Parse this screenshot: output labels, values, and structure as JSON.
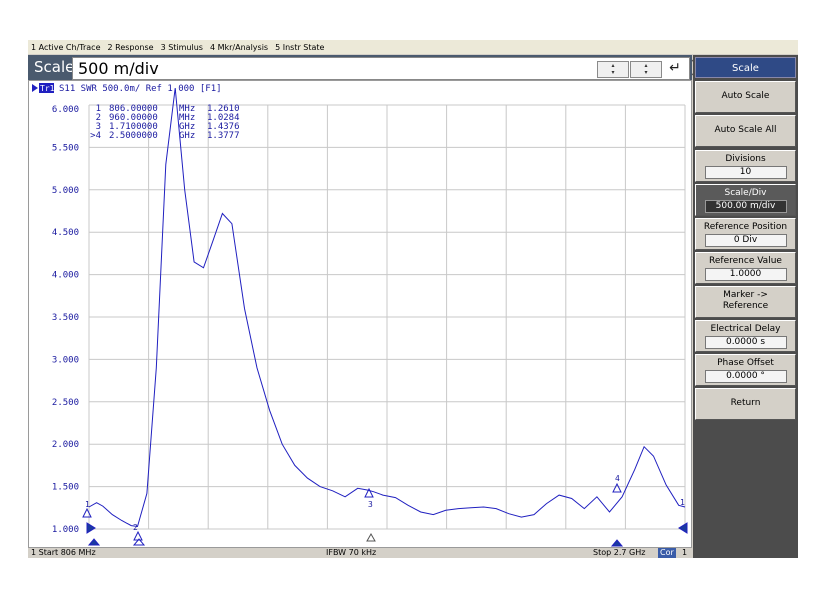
{
  "menu": [
    "1 Active Ch/Trace",
    "2 Response",
    "3 Stimulus",
    "4 Mkr/Analysis",
    "5 Instr State"
  ],
  "entry": {
    "label": "Scale",
    "value": "500 m/div",
    "up_arrow": "▴",
    "down_arrow": "▾",
    "enter_glyph": "↵"
  },
  "trace_header": {
    "tag": "Tr1",
    "text": "S11  SWR 500.0m/ Ref 1.000 [F1]"
  },
  "y_axis": {
    "labels": [
      "6.000",
      "5.500",
      "5.000",
      "4.500",
      "4.000",
      "3.500",
      "3.000",
      "2.500",
      "2.000",
      "1.500",
      "1.000"
    ]
  },
  "markers": [
    {
      "id": "1",
      "freq": "806.00000",
      "unit": "MHz",
      "value": "1.2610"
    },
    {
      "id": "2",
      "freq": "960.00000",
      "unit": "MHz",
      "value": "1.0284"
    },
    {
      "id": "3",
      "freq": "1.7100000",
      "unit": "GHz",
      "value": "1.4376"
    },
    {
      "id": ">4",
      "freq": "2.5000000",
      "unit": "GHz",
      "value": "1.3777"
    }
  ],
  "marker_tags": {
    "m1": "1",
    "m2": "2",
    "m3": "3",
    "m4": "4",
    "end": "1"
  },
  "softkeys": {
    "title": "Scale",
    "items": [
      {
        "label": "Auto Scale"
      },
      {
        "label": "Auto Scale All"
      },
      {
        "label": "Divisions",
        "value": "10"
      },
      {
        "label": "Scale/Div",
        "value": "500.00 m/div"
      },
      {
        "label": "Reference Position",
        "value": "0 Div"
      },
      {
        "label": "Reference Value",
        "value": "1.0000"
      },
      {
        "label": "Marker ->",
        "label2": "Reference"
      },
      {
        "label": "Electrical Delay",
        "value": "0.0000 s"
      },
      {
        "label": "Phase Offset",
        "value": "0.0000 °"
      },
      {
        "label": "Return"
      }
    ]
  },
  "status": {
    "start": "1  Start 806 MHz",
    "ifbw": "IFBW 70 kHz",
    "stop": "Stop 2.7 GHz",
    "cor": "Cor",
    "ch": "1"
  },
  "colors": {
    "trace": "#2020c0",
    "grid": "#c8c8c8",
    "label": "#1a1aa0",
    "softkey_title": "#2f4a86",
    "active_softkey": "#5a5a5a"
  },
  "chart_data": {
    "type": "line",
    "title": "S11 SWR",
    "ylim": [
      1.0,
      6.0
    ],
    "xlim": [
      806,
      2700
    ],
    "xlabel": "",
    "ylabel": "",
    "grid": true,
    "series": [
      {
        "name": "Tr1",
        "x": [
          806,
          830,
          850,
          880,
          910,
          940,
          960,
          990,
          1020,
          1050,
          1080,
          1110,
          1140,
          1170,
          1200,
          1230,
          1260,
          1300,
          1340,
          1380,
          1420,
          1460,
          1500,
          1540,
          1580,
          1620,
          1660,
          1690,
          1710,
          1740,
          1780,
          1820,
          1860,
          1900,
          1940,
          1980,
          2020,
          2060,
          2100,
          2140,
          2180,
          2220,
          2260,
          2300,
          2340,
          2380,
          2420,
          2460,
          2500,
          2540,
          2570,
          2600,
          2640,
          2680,
          2700
        ],
        "y": [
          1.26,
          1.31,
          1.27,
          1.17,
          1.1,
          1.04,
          1.03,
          1.42,
          2.9,
          5.3,
          6.2,
          5.0,
          4.15,
          4.08,
          4.4,
          4.72,
          4.6,
          3.6,
          2.9,
          2.4,
          2.0,
          1.75,
          1.6,
          1.5,
          1.45,
          1.38,
          1.48,
          1.46,
          1.44,
          1.4,
          1.37,
          1.28,
          1.2,
          1.17,
          1.22,
          1.24,
          1.25,
          1.26,
          1.24,
          1.18,
          1.14,
          1.17,
          1.3,
          1.4,
          1.36,
          1.24,
          1.38,
          1.2,
          1.38,
          1.7,
          1.97,
          1.86,
          1.52,
          1.28,
          1.26
        ]
      }
    ]
  }
}
